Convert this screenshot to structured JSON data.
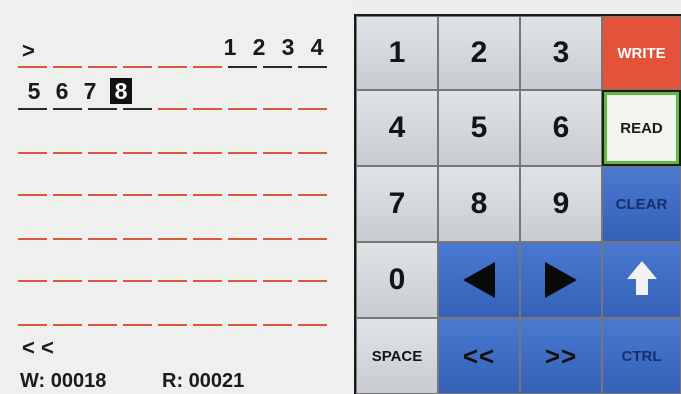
{
  "terminal": {
    "prompt_in": ">",
    "row1_chars": [
      "1",
      "2",
      "3",
      "4"
    ],
    "row2_chars": [
      "5",
      "6",
      "7",
      "8"
    ],
    "cursor_char": "8",
    "prompt_out": "< <",
    "status_w": "W: 00018",
    "status_r": "R: 00021"
  },
  "keypad": {
    "k1": "1",
    "k2": "2",
    "k3": "3",
    "k4": "4",
    "k5": "5",
    "k6": "6",
    "k7": "7",
    "k8": "8",
    "k9": "9",
    "k0": "0",
    "write": "WRITE",
    "read": "READ",
    "clear": "CLEAR",
    "space": "SPACE",
    "back_word": "<<",
    "fwd_word": ">>",
    "ctrl": "CTRL",
    "left_icon": "left-arrow-icon",
    "right_icon": "right-arrow-icon",
    "up_icon": "up-arrow-icon"
  },
  "colors": {
    "write_red": "#e2533a",
    "read_border_green": "#5fb945",
    "keypad_blue": "#3d6cc3",
    "underline_red": "#d9573b"
  }
}
